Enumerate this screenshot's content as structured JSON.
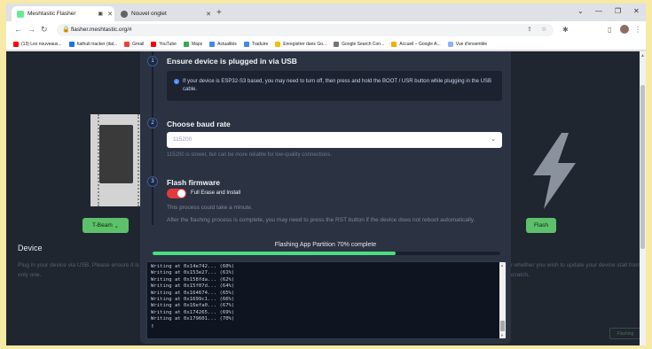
{
  "browser": {
    "tabs": [
      {
        "title": "Meshtastic Flasher",
        "color": "#67ea94"
      },
      {
        "title": "Nouvel onglet",
        "color": "#5f6368"
      }
    ],
    "url": "flasher.meshtastic.org/#",
    "bookmarks": [
      {
        "label": "(13) Les nouveaux...",
        "color": "#ff0000"
      },
      {
        "label": "hathub tracker (ital...",
        "color": "#1a73e8"
      },
      {
        "label": "Gmail",
        "color": "#ea4335"
      },
      {
        "label": "YouTube",
        "color": "#ff0000"
      },
      {
        "label": "Maps",
        "color": "#34a853"
      },
      {
        "label": "Actualités",
        "color": "#4285f4"
      },
      {
        "label": "Traduire",
        "color": "#4285f4"
      },
      {
        "label": "Enregistrer dans Go...",
        "color": "#fbbc05"
      },
      {
        "label": "Google Search Con...",
        "color": "#757575"
      },
      {
        "label": "Accueil – Google A...",
        "color": "#f9ab00"
      },
      {
        "label": "Vue d'ensemble",
        "color": "#8ab4f8"
      }
    ]
  },
  "background": {
    "device_button": "T-Beam",
    "flash_button": "Flash",
    "device_title": "Device",
    "device_desc": "Plug in your device via USB. Please ensure it is only one.",
    "right_desc": "e whether you wish to update your device stall from scratch.",
    "flash_small": "Flashing"
  },
  "modal": {
    "steps": [
      {
        "num": "1",
        "title": "Ensure device is plugged in via USB"
      },
      {
        "num": "2",
        "title": "Choose baud rate"
      },
      {
        "num": "3",
        "title": "Flash firmware"
      }
    ],
    "info_text": "If your device is ESP32-S3 based, you may need to turn off, then press and hold the BOOT / USR button while plugging in the USB cable.",
    "baud_value": "115200",
    "baud_hint": "115200 is slower, but can be more reliable for low-quality connections.",
    "toggle_label": "Full Erase and Install",
    "toggle_on": true,
    "desc1": "This process could take a minute.",
    "desc2": "After the flashing process is complete, you may need to press the RST button if the device does not reboot automatically.",
    "progress_label": "Flashing App Partition 70% complete",
    "progress_percent": 70,
    "progress_color": "#4ade80",
    "console_lines": [
      "Writing at 0x14e742... (60%)",
      "Writing at 0x153e27... (61%)",
      "Writing at 0x158fda... (62%)",
      "Writing at 0x15f07d... (64%)",
      "Writing at 0x164674... (65%)",
      "Writing at 0x1699c1... (66%)",
      "Writing at 0x16efa0... (67%)",
      "Writing at 0x174265... (69%)",
      "Writing at 0x179601... (70%)"
    ]
  }
}
